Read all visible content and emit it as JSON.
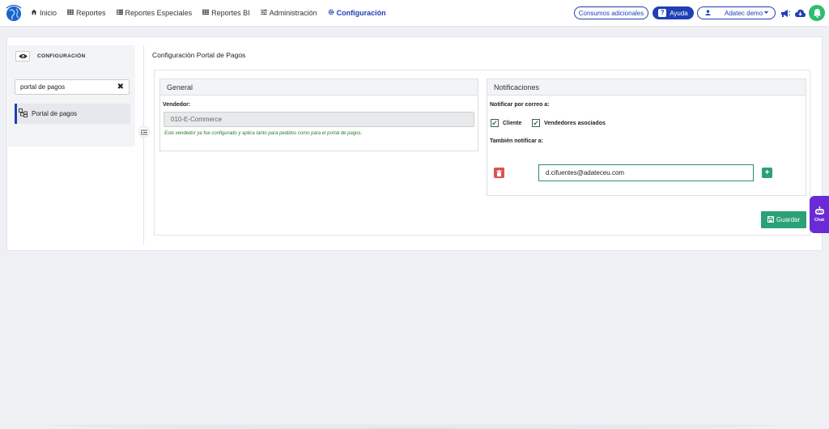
{
  "nav": {
    "items": [
      {
        "label": "Inicio",
        "icon": "home-icon"
      },
      {
        "label": "Reportes",
        "icon": "grid-icon"
      },
      {
        "label": "Reportes Especiales",
        "icon": "list-icon"
      },
      {
        "label": "Reportes BI",
        "icon": "grid-icon"
      },
      {
        "label": "Administración",
        "icon": "sliders-icon"
      },
      {
        "label": "Configuración",
        "icon": "gear-icon"
      }
    ],
    "active": "Configuración"
  },
  "toolbar": {
    "consumos_label": "Consumos adicionales",
    "help_label": "Ayuda",
    "user_label": "Adatec demo"
  },
  "sidebar": {
    "title": "CONFIGURACIÓN",
    "search_value": "portal de pagos",
    "items": [
      {
        "label": "Portal de pagos"
      }
    ]
  },
  "page": {
    "title": "Configuración Portal de Pagos"
  },
  "general": {
    "title": "General",
    "vendor_label": "Vendedor:",
    "vendor_value": "010-E-Commerce",
    "hint": "Este vendedor ya fue configurado y aplica tanto para pedidos como para el portal de pagos."
  },
  "notifications": {
    "title": "Notificaciones",
    "notify_label": "Notificar por correo a:",
    "options": [
      {
        "label": "Cliente",
        "checked": true
      },
      {
        "label": "Vendedores asociados",
        "checked": true
      }
    ],
    "also_label": "También notificar a:",
    "emails": [
      "d.cifuentes@adateceu.com"
    ]
  },
  "actions": {
    "save_label": "Guardar"
  },
  "chat": {
    "label": "Chat"
  },
  "colors": {
    "primary": "#1f3fb5",
    "success": "#2aa176",
    "danger": "#d9534f",
    "chat": "#6a2bd6"
  }
}
